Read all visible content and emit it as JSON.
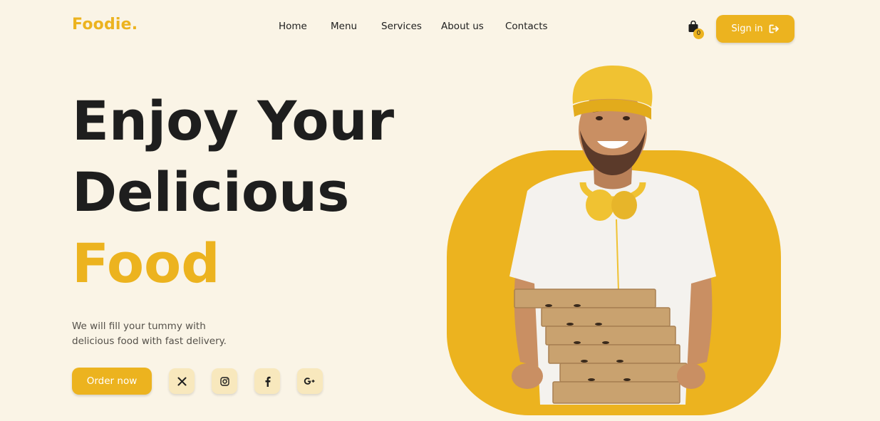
{
  "brand": {
    "logo": "Foodie."
  },
  "nav": {
    "items": [
      {
        "label": "Home"
      },
      {
        "label": "Menu"
      },
      {
        "label": "Services"
      },
      {
        "label": "About us"
      },
      {
        "label": "Contacts"
      }
    ]
  },
  "cart": {
    "count": "0",
    "icon": "shopping-bag-icon"
  },
  "auth": {
    "signin_label": "Sign in",
    "icon": "sign-out-arrow-icon"
  },
  "hero": {
    "line1": "Enjoy Your",
    "line2": "Delicious",
    "line3": "Food",
    "subtitle": "We will fill your tummy with delicious food with fast delivery.",
    "cta_label": "Order now"
  },
  "social": [
    {
      "icon": "x-twitter-icon"
    },
    {
      "icon": "instagram-icon"
    },
    {
      "icon": "facebook-icon"
    },
    {
      "icon": "google-plus-icon"
    }
  ],
  "colors": {
    "background": "#faf4e6",
    "accent": "#ecb31f",
    "text": "#1e1e1e",
    "social_bg": "#f8e8bd"
  }
}
